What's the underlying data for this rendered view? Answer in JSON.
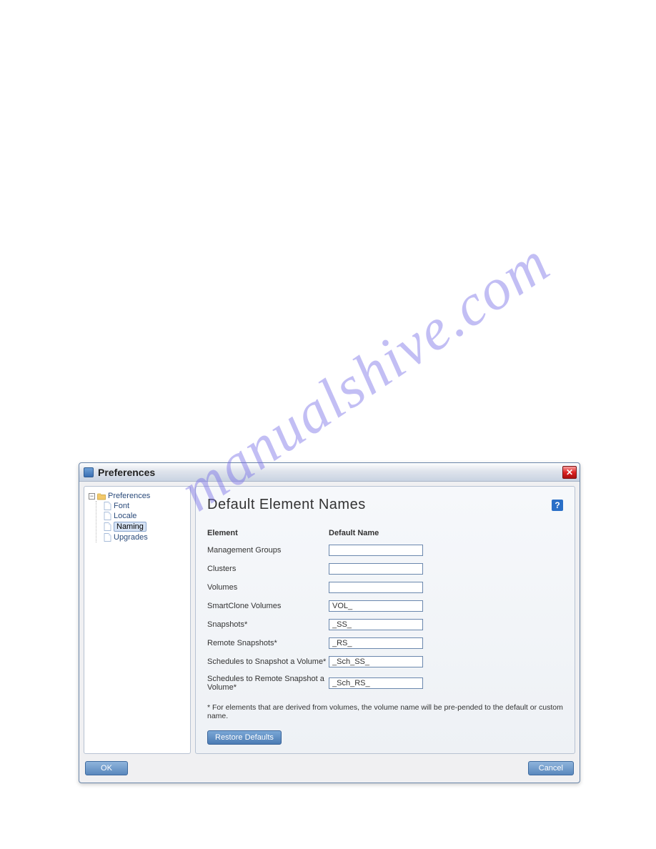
{
  "watermark": "manualshive.com",
  "dialog": {
    "title": "Preferences",
    "tree": {
      "root": "Preferences",
      "items": [
        "Font",
        "Locale",
        "Naming",
        "Upgrades"
      ],
      "selectedIndex": 2
    },
    "content": {
      "title": "Default Element Names",
      "columns": {
        "element": "Element",
        "defaultName": "Default Name"
      },
      "rows": [
        {
          "label": "Management Groups",
          "value": ""
        },
        {
          "label": "Clusters",
          "value": ""
        },
        {
          "label": "Volumes",
          "value": ""
        },
        {
          "label": "SmartClone Volumes",
          "value": "VOL_"
        },
        {
          "label": "Snapshots*",
          "value": "_SS_"
        },
        {
          "label": "Remote Snapshots*",
          "value": "_RS_"
        },
        {
          "label": "Schedules to Snapshot a Volume*",
          "value": "_Sch_SS_"
        },
        {
          "label": "Schedules to Remote Snapshot a Volume*",
          "value": "_Sch_RS_"
        }
      ],
      "footnote": "* For elements that are derived from volumes, the volume name will be pre-pended to the default or custom name.",
      "restoreLabel": "Restore Defaults"
    },
    "buttons": {
      "ok": "OK",
      "cancel": "Cancel"
    }
  }
}
